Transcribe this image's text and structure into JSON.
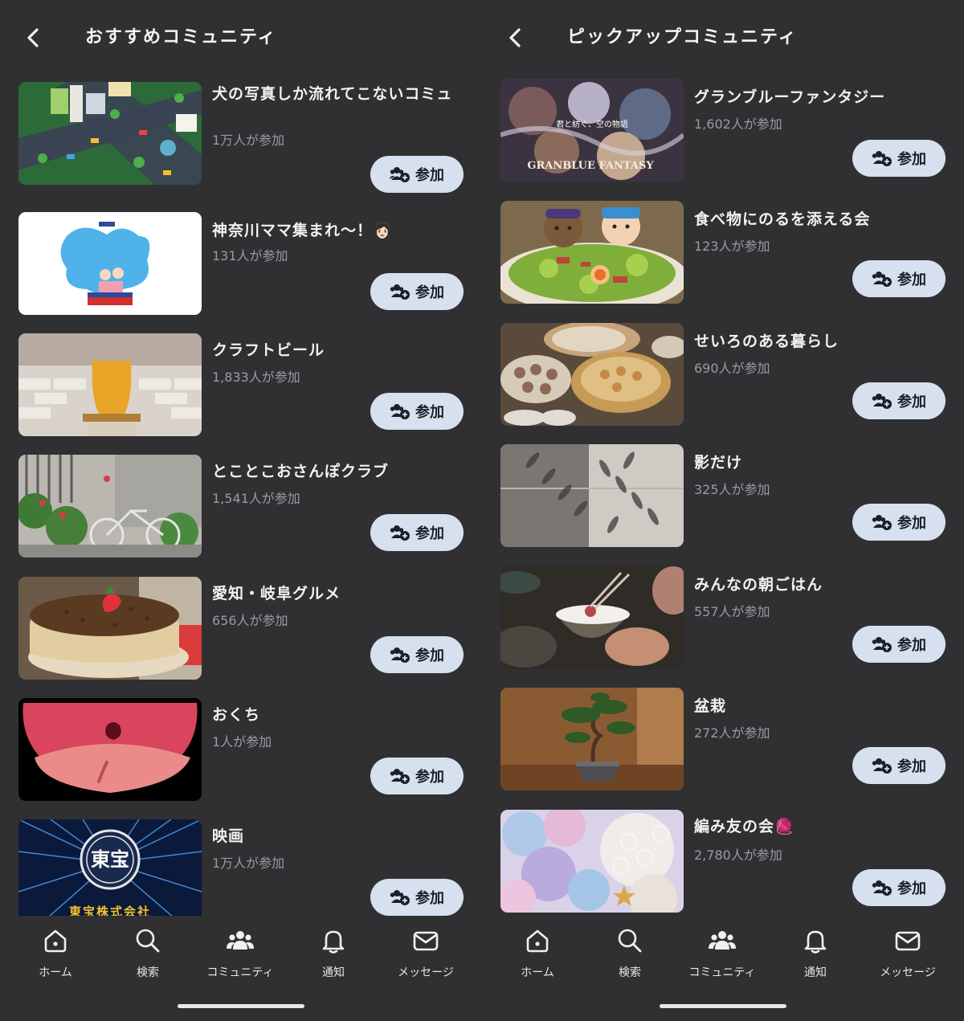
{
  "left": {
    "title": "おすすめコミュニティ",
    "items": [
      {
        "name": "犬の写真しか流れてこないコミュ",
        "count": "1万人が参加",
        "join": "参加"
      },
      {
        "name": "神奈川ママ集まれ〜！👩🏻",
        "count": "131人が参加",
        "join": "参加"
      },
      {
        "name": "クラフトビール",
        "count": "1,833人が参加",
        "join": "参加"
      },
      {
        "name": "とことこおさんぽクラブ",
        "count": "1,541人が参加",
        "join": "参加"
      },
      {
        "name": "愛知・岐阜グルメ",
        "count": "656人が参加",
        "join": "参加"
      },
      {
        "name": "おくち",
        "count": "1人が参加",
        "join": "参加"
      },
      {
        "name": "映画",
        "count": "1万人が参加",
        "join": "参加",
        "thumb_text": "東宝株式会社",
        "thumb_logo": "東宝"
      }
    ]
  },
  "right": {
    "title": "ピックアップコミュニティ",
    "items": [
      {
        "name": "グランブルーファンタジー",
        "count": "1,602人が参加",
        "join": "参加",
        "thumb_text": "GRANBLUE FANTASY",
        "thumb_sub": "君と紡ぐ、空の物語"
      },
      {
        "name": "食べ物にのるを添える会",
        "count": "123人が参加",
        "join": "参加"
      },
      {
        "name": "せいろのある暮らし",
        "count": "690人が参加",
        "join": "参加"
      },
      {
        "name": "影だけ",
        "count": "325人が参加",
        "join": "参加"
      },
      {
        "name": "みんなの朝ごはん",
        "count": "557人が参加",
        "join": "参加"
      },
      {
        "name": "盆栽",
        "count": "272人が参加",
        "join": "参加"
      },
      {
        "name": "編み友の会🧶",
        "count": "2,780人が参加",
        "join": "参加"
      }
    ]
  },
  "tabbar": {
    "tabs": [
      {
        "label": "ホーム",
        "icon": "home-icon"
      },
      {
        "label": "検索",
        "icon": "search-icon"
      },
      {
        "label": "コミュニティ",
        "icon": "community-icon"
      },
      {
        "label": "通知",
        "icon": "bell-icon"
      },
      {
        "label": "メッセージ",
        "icon": "mail-icon"
      }
    ]
  },
  "colors": {
    "background": "#303032",
    "join_button_bg": "#d7e0ee",
    "join_button_text": "#1d1f27",
    "count_text": "#9a9aa4"
  }
}
